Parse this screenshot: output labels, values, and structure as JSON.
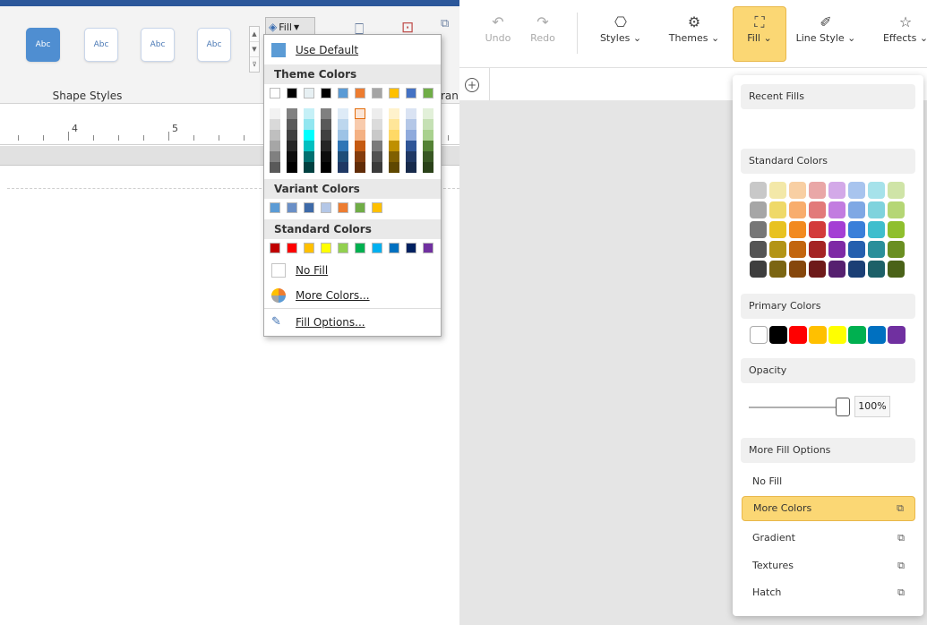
{
  "left_ribbon": {
    "shape_style_labels": [
      "Abc",
      "Abc",
      "Abc",
      "Abc"
    ],
    "group_label": "Shape Styles",
    "fill_button_label": "Fill",
    "partial_label": "ran",
    "ruler_numbers": [
      "4",
      "5"
    ]
  },
  "fill_dropdown": {
    "use_default": "Use Default",
    "theme_colors_header": "Theme Colors",
    "theme_top_row": [
      "#ffffff",
      "#000000",
      "#e7f0f3",
      "#000000",
      "#5b9bd5",
      "#ed7d31",
      "#a5a5a5",
      "#ffc000",
      "#4472c4",
      "#70ad47"
    ],
    "theme_shade_columns": [
      [
        "#f2f2f2",
        "#d9d9d9",
        "#bfbfbf",
        "#a6a6a6",
        "#808080",
        "#595959"
      ],
      [
        "#808080",
        "#595959",
        "#404040",
        "#262626",
        "#0d0d0d",
        "#000000"
      ],
      [
        "#c5f0f7",
        "#91e6f0",
        "#00ffff",
        "#00c0c0",
        "#007070",
        "#004040"
      ],
      [
        "#808080",
        "#595959",
        "#404040",
        "#262626",
        "#0d0d0d",
        "#000000"
      ],
      [
        "#deebf7",
        "#bdd7ee",
        "#9dc3e6",
        "#2e75b6",
        "#1f4e79",
        "#1f3864"
      ],
      [
        "#fbe5d6",
        "#f8cbad",
        "#f4b183",
        "#c55a11",
        "#843c0c",
        "#612c07"
      ],
      [
        "#ededed",
        "#dbdbdb",
        "#c9c9c9",
        "#7b7b7b",
        "#525252",
        "#3b3b3b"
      ],
      [
        "#fff2cc",
        "#ffe699",
        "#ffd966",
        "#bf9000",
        "#806000",
        "#5f4800"
      ],
      [
        "#dae3f3",
        "#b4c7e7",
        "#8faadc",
        "#2f5597",
        "#203864",
        "#172a4b"
      ],
      [
        "#e2f0d9",
        "#c5e0b4",
        "#a9d18e",
        "#548235",
        "#385723",
        "#2a4119"
      ]
    ],
    "variant_colors_header": "Variant Colors",
    "variant_colors": [
      "#5b9bd5",
      "#6a8fc6",
      "#3e6aa8",
      "#b4c7e7",
      "#ed7d31",
      "#70ad47",
      "#ffc000"
    ],
    "standard_colors_header": "Standard Colors",
    "standard_colors": [
      "#c00000",
      "#ff0000",
      "#ffc000",
      "#ffff00",
      "#92d050",
      "#00b050",
      "#00b0f0",
      "#0070c0",
      "#002060",
      "#7030a0"
    ],
    "no_fill": "No Fill",
    "more_colors": "More Colors...",
    "fill_options": "Fill Options..."
  },
  "right_toolbar": {
    "undo": "Undo",
    "redo": "Redo",
    "styles": "Styles",
    "themes": "Themes",
    "fill": "Fill",
    "line_style": "Line Style",
    "effects": "Effects"
  },
  "fill_panel": {
    "recent_fills": "Recent Fills",
    "standard_colors": "Standard Colors",
    "standard_grid": [
      [
        "#c8c8c8",
        "#f3e8a8",
        "#f8cfa3",
        "#e9a7a7",
        "#d3a9e8",
        "#a8c4ee",
        "#a6e2ea",
        "#cfe4a7"
      ],
      [
        "#a6a6a6",
        "#efd968",
        "#f8ad6d",
        "#e27a7a",
        "#c27ce0",
        "#7fa8e4",
        "#7fd3dd",
        "#b5d675"
      ],
      [
        "#777777",
        "#e8c220",
        "#f28a20",
        "#d33b3b",
        "#a43fd4",
        "#3a7fd9",
        "#3fbecd",
        "#8fbf2e"
      ],
      [
        "#555555",
        "#b39416",
        "#c2650e",
        "#a42424",
        "#7e2aa5",
        "#255fae",
        "#2a8f9a",
        "#6a8f22"
      ],
      [
        "#3e3e3e",
        "#7b6512",
        "#86470c",
        "#6e1a1a",
        "#56206f",
        "#1b3f75",
        "#1d6068",
        "#4a6218"
      ]
    ],
    "primary_colors": "Primary Colors",
    "primary_swatches": [
      "#ffffff",
      "#000000",
      "#ff0000",
      "#ffc000",
      "#ffff00",
      "#00b050",
      "#0070c0",
      "#7030a0"
    ],
    "opacity": "Opacity",
    "opacity_value": "100%",
    "more_fill_options": "More Fill Options",
    "no_fill": "No Fill",
    "more_colors": "More Colors",
    "gradient": "Gradient",
    "textures": "Textures",
    "hatch": "Hatch"
  }
}
